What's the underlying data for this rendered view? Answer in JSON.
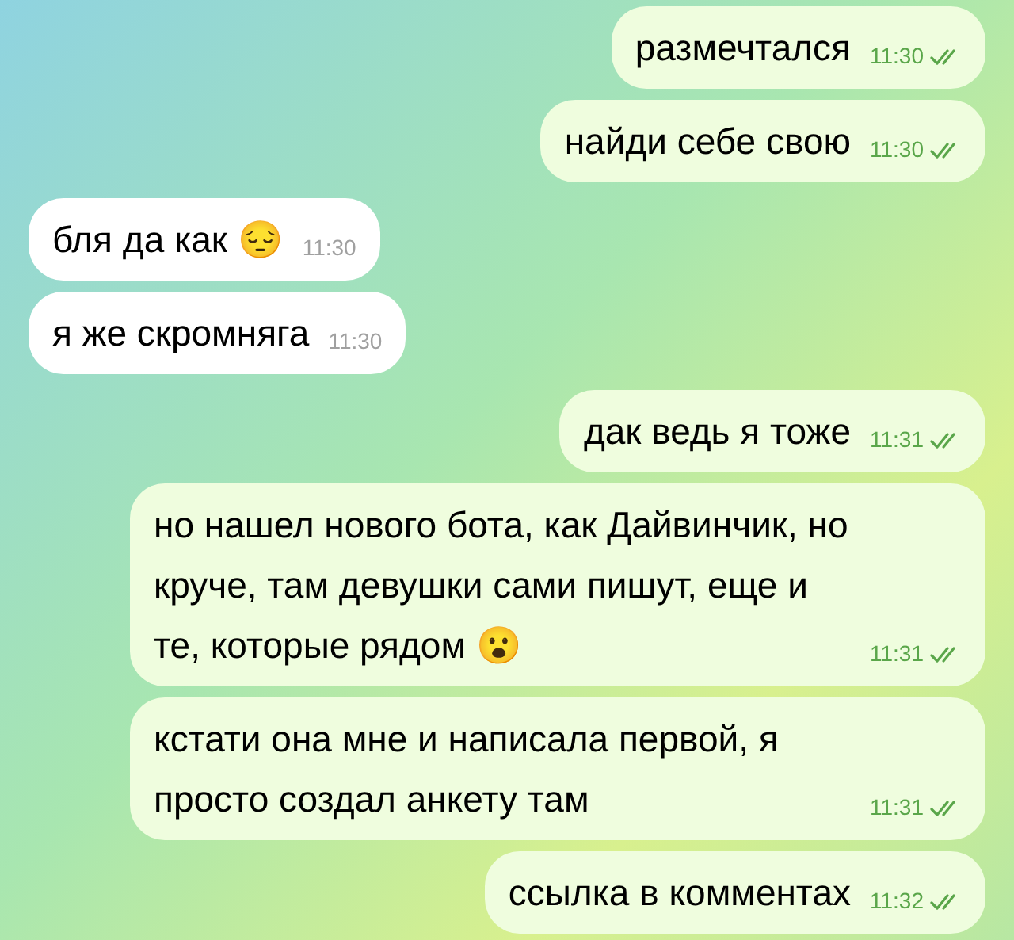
{
  "messages": [
    {
      "kind": "outgoing",
      "text": "размечтался",
      "time": "11:30",
      "read": true
    },
    {
      "kind": "outgoing",
      "text": "найди себе свою",
      "time": "11:30",
      "read": true
    },
    {
      "kind": "incoming",
      "text": "бля да как 😔",
      "time": "11:30"
    },
    {
      "kind": "incoming",
      "text": "я же скромняга",
      "time": "11:30"
    },
    {
      "kind": "outgoing",
      "text": "дак ведь я тоже",
      "time": "11:31",
      "read": true
    },
    {
      "kind": "outgoing",
      "text": "но нашел нового бота, как Дайвинчик, но круче, там девушки сами пишут, еще и те, которые рядом 😮",
      "time": "11:31",
      "read": true
    },
    {
      "kind": "outgoing",
      "text": "кстати она мне и написала первой, я просто создал анкету там",
      "time": "11:31",
      "read": true
    },
    {
      "kind": "outgoing",
      "text": "ссылка в комментах",
      "time": "11:32",
      "read": true
    }
  ]
}
